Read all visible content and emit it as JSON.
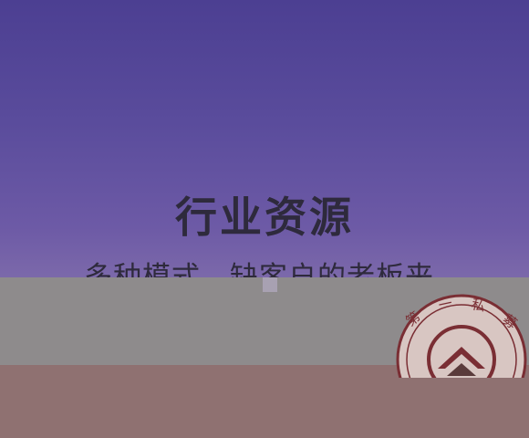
{
  "headline": {
    "title": "行业资源",
    "subtitle": "多种模式，缺客户的老板来"
  },
  "watermark": {
    "text": "第一私募",
    "ring_color": "#7a2e34",
    "fill_color": "#d9c8c5"
  },
  "colors": {
    "bg_top": "#4c3f92",
    "bg_bottom": "#8a7aa9",
    "text": "#2e2a3c",
    "gray_overlay": "#8e8b8c",
    "rose_band": "#8f7171"
  }
}
